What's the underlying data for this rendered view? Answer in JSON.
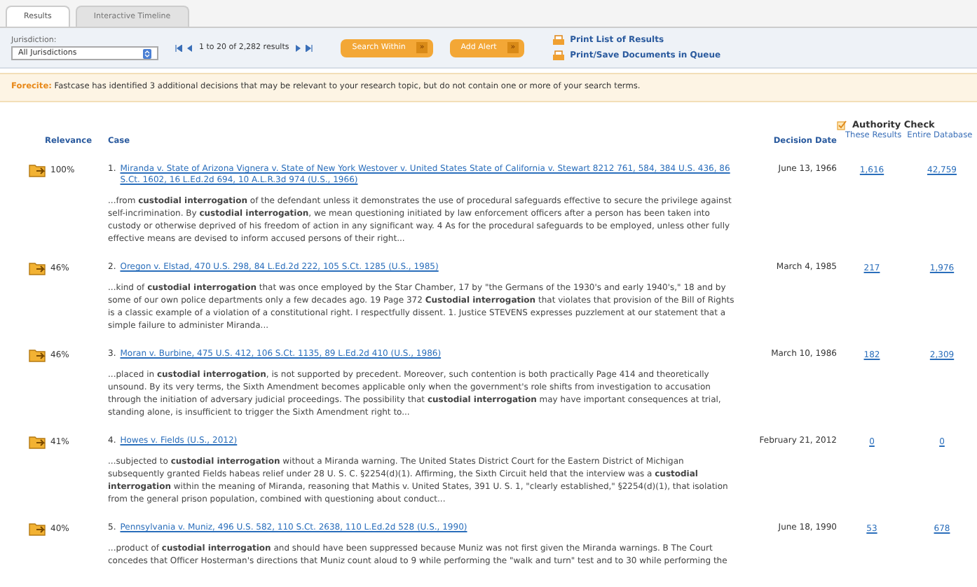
{
  "tabs": [
    {
      "label": "Results",
      "selected": true
    },
    {
      "label": "Interactive Timeline",
      "selected": false
    }
  ],
  "toolbar": {
    "jurisdiction_label": "Jurisdiction:",
    "jurisdiction_value": "All Jurisdictions",
    "range": "1 to 20 of 2,282 results",
    "buttons": [
      {
        "label": "Search Within",
        "arrow": "»"
      },
      {
        "label": "Add Alert",
        "arrow": "»"
      }
    ],
    "links": [
      "Print List of Results",
      "Print/Save Documents in Queue"
    ]
  },
  "forecite": {
    "label": "Forecite:",
    "text": "Fastcase has identified 3 additional decisions that may be relevant to your research topic, but do not contain one or more of your search terms."
  },
  "authority_check": {
    "title": "Authority Check",
    "columns": [
      "These Results",
      "Entire Database"
    ]
  },
  "columns": [
    "Relevance",
    "Case",
    "Decision Date"
  ],
  "rows": [
    {
      "relevance": "100%",
      "number": "1.",
      "citation": "Miranda v. State of Arizona Vignera v. State of New York Westover v. United States State of California v. Stewart 8212 761, 584, 384 U.S. 436, 86 S.Ct. 1602, 16 L.Ed.2d 694, 10 A.L.R.3d 974 (U.S., 1966)",
      "date": "June 13, 1966",
      "these_results": "1,616",
      "entire_database": "42,759",
      "snippet": "...from **custodial interrogation** of the defendant unless it demonstrates the use of procedural safeguards effective to secure the privilege against self-incrimination. By **custodial interrogation**, we mean questioning initiated by law enforcement officers after a person has been taken into custody or otherwise deprived of his freedom of action in any significant way. 4 As for the procedural safeguards to be employed, unless other fully effective means are devised to inform accused persons of their right..."
    },
    {
      "relevance": "46%",
      "number": "2.",
      "citation": "Oregon v. Elstad, 470 U.S. 298, 84 L.Ed.2d 222, 105 S.Ct. 1285 (U.S., 1985)",
      "date": "March 4, 1985",
      "these_results": "217",
      "entire_database": "1,976",
      "snippet": "...kind of **custodial interrogation** that was once employed by the Star Chamber, 17 by \"the Germans of the 1930's and early 1940's,\" 18 and by some of our own police departments only a few decades ago. 19  Page 372 **Custodial interrogation** that violates that provision of the Bill of Rights is a classic example of a violation of a constitutional right.          I respectfully dissent. 1. Justice STEVENS expresses puzzlement at our statement that a simple failure to administer Miranda..."
    },
    {
      "relevance": "46%",
      "number": "3.",
      "citation": "Moran v. Burbine, 475 U.S. 412, 106 S.Ct. 1135, 89 L.Ed.2d 410 (U.S., 1986)",
      "date": "March 10, 1986",
      "these_results": "182",
      "entire_database": "2,309",
      "snippet": "...placed in **custodial interrogation**, is not supported by precedent. Moreover, such contention is both practically  Page 414 and theoretically unsound. By its very terms, the Sixth Amendment becomes applicable only when the government's role shifts from investigation to accusation through the initiation of adversary judicial proceedings. The possibility that **custodial interrogation** may have important consequences at trial, standing alone, is insufficient to trigger the Sixth Amendment right to..."
    },
    {
      "relevance": "41%",
      "number": "4.",
      "citation": "Howes v. Fields (U.S., 2012)",
      "date": "February 21, 2012",
      "these_results": "0",
      "entire_database": "0",
      "snippet": "...subjected to **custodial interrogation** without a Miranda warning. The United States District Court for the Eastern District of Michigan subsequently granted Fields habeas relief under 28 U. S. C. §2254(d)(1). Affirming, the Sixth Circuit held that the interview was a **custodial interrogation** within the meaning of Miranda, reasoning that Mathis v. United States, 391 U. S. 1, \"clearly established,\" §2254(d)(1), that isolation from the general prison population, combined with questioning about conduct..."
    },
    {
      "relevance": "40%",
      "number": "5.",
      "citation": "Pennsylvania v. Muniz, 496 U.S. 582, 110 S.Ct. 2638, 110 L.Ed.2d 528 (U.S., 1990)",
      "date": "June 18, 1990",
      "these_results": "53",
      "entire_database": "678",
      "snippet": "...product of **custodial interrogation** and should have been suppressed because Muniz was not first given the Miranda warnings. B          The Court concedes that Officer Hosterman's directions that Muniz count aloud to 9 while performing the \"walk and turn\" test and to 30 while performing the"
    }
  ]
}
